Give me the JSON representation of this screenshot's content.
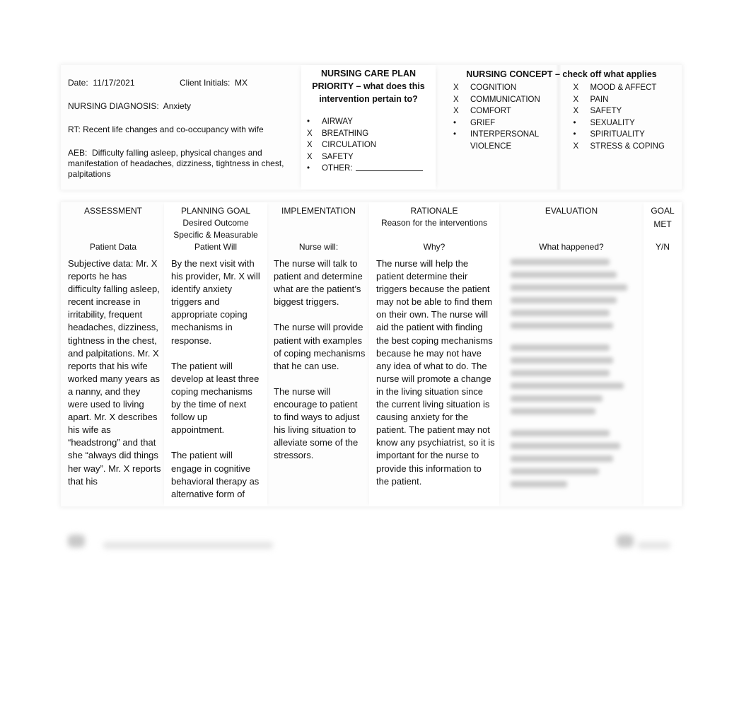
{
  "header": {
    "date_label": "Date:",
    "date_value": "11/17/2021",
    "client_initials_label": "Client Initials:",
    "client_initials_value": "MX",
    "nursing_diagnosis_label": "NURSING DIAGNOSIS:",
    "nursing_diagnosis_value": "Anxiety",
    "rt_label": "RT:",
    "rt_value": "Recent life changes and co-occupancy with wife",
    "aeb_label": "AEB:",
    "aeb_value": "Difficulty falling asleep, physical changes and manifestation of headaches, dizziness, tightness in chest, palpitations"
  },
  "priority": {
    "title": "NURSING CARE PLAN PRIORITY – what does this intervention pertain to?",
    "items": [
      {
        "mark": "•",
        "label": "AIRWAY"
      },
      {
        "mark": "X",
        "label": "BREATHING"
      },
      {
        "mark": "X",
        "label": "CIRCULATION"
      },
      {
        "mark": "X",
        "label": "SAFETY"
      },
      {
        "mark": "•",
        "label": "OTHER:",
        "value": ""
      }
    ]
  },
  "concept": {
    "title": "NURSING CONCEPT – check off what applies",
    "left": [
      {
        "mark": "X",
        "label": "COGNITION"
      },
      {
        "mark": "X",
        "label": "COMMUNICATION"
      },
      {
        "mark": "X",
        "label": "COMFORT"
      },
      {
        "mark": "•",
        "label": "GRIEF"
      },
      {
        "mark": "•",
        "label": "INTERPERSONAL"
      },
      {
        "mark": "",
        "label": "VIOLENCE"
      }
    ],
    "right": [
      {
        "mark": "X",
        "label": "MOOD & AFFECT"
      },
      {
        "mark": "X",
        "label": "PAIN"
      },
      {
        "mark": "X",
        "label": "SAFETY"
      },
      {
        "mark": "•",
        "label": "SEXUALITY"
      },
      {
        "mark": "•",
        "label": "SPIRITUALITY"
      },
      {
        "mark": "X",
        "label": "STRESS & COPING"
      }
    ]
  },
  "table": {
    "columns": [
      {
        "title": "ASSESSMENT",
        "subtitle": "",
        "prompt": "Patient Data"
      },
      {
        "title": "PLANNING GOAL",
        "subtitle": "Desired Outcome\nSpecific & Measurable",
        "prompt": "Patient Will"
      },
      {
        "title": "IMPLEMENTATION",
        "subtitle": "",
        "prompt": "Nurse will:"
      },
      {
        "title": "RATIONALE",
        "subtitle": "Reason for the interventions",
        "prompt": "Why?"
      },
      {
        "title": "EVALUATION",
        "subtitle": "",
        "prompt": "What happened?"
      },
      {
        "title": "GOAL",
        "subtitle": "MET",
        "prompt": "Y/N"
      }
    ],
    "assessment": "Subjective data: Mr. X reports he has difficulty falling asleep, recent increase in irritability, frequent headaches, dizziness, tightness in the chest, and palpitations. Mr. X reports that his wife worked many years as a nanny, and they were used to living apart. Mr. X describes his wife as “headstrong” and that she “always did things her way”. Mr. X reports that his",
    "planning": "By the next visit with his provider, Mr. X will identify anxiety triggers and appropriate coping mechanisms in response.\n\nThe patient will develop at least three coping mechanisms by the time of next follow up appointment.\n\nThe patient will engage in cognitive behavioral therapy as alternative form of",
    "implementation": "The nurse will talk to patient and determine what are the patient’s biggest triggers.\n\nThe nurse will provide patient with examples of coping mechanisms that he can use.\n\nThe nurse will encourage to patient to find ways to adjust his living situation to alleviate some of the stressors.",
    "rationale": "The nurse will help the patient determine their triggers because the patient may not be able to find them on their own. The nurse will aid the patient with finding the best coping mechanisms because he may not have any idea of what to do. The nurse will promote a change in the living situation since the current living situation is causing anxiety for the patient. The patient may not know any psychiatrist, so it is important for the nurse to provide this information to the patient.",
    "evaluation": "",
    "goal_met": ""
  }
}
